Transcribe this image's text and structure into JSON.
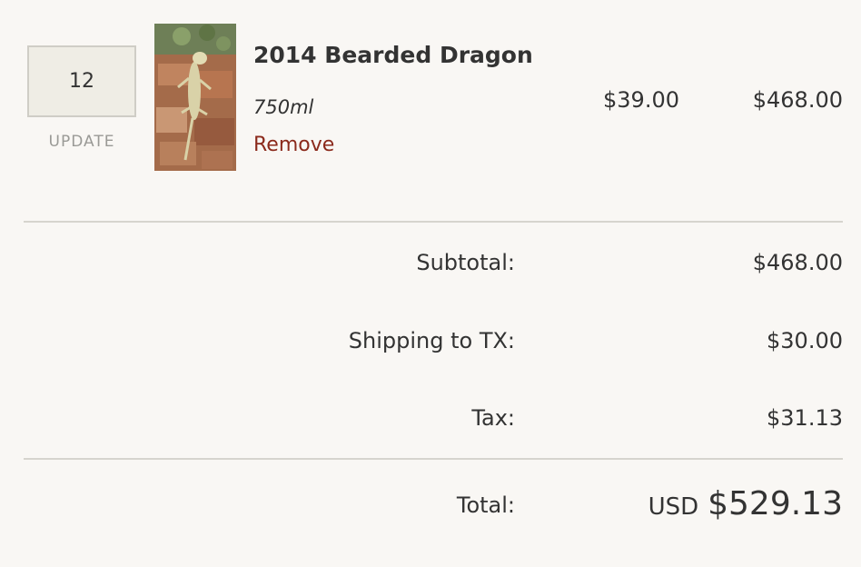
{
  "cart": {
    "item": {
      "quantity": "12",
      "update_label": "UPDATE",
      "name": "2014 Bearded Dragon",
      "size": "750ml",
      "remove_label": "Remove",
      "unit_price": "$39.00",
      "line_total": "$468.00"
    }
  },
  "summary": {
    "subtotal_label": "Subtotal:",
    "subtotal_value": "$468.00",
    "shipping_label": "Shipping to TX:",
    "shipping_value": "$30.00",
    "tax_label": "Tax:",
    "tax_value": "$31.13",
    "total_label": "Total:",
    "currency": "USD",
    "total_value": "$529.13"
  },
  "colors": {
    "background": "#f9f7f4",
    "remove_link": "#8b2a1c",
    "qty_box_bg": "#efede5",
    "divider": "#d6d4ce"
  }
}
